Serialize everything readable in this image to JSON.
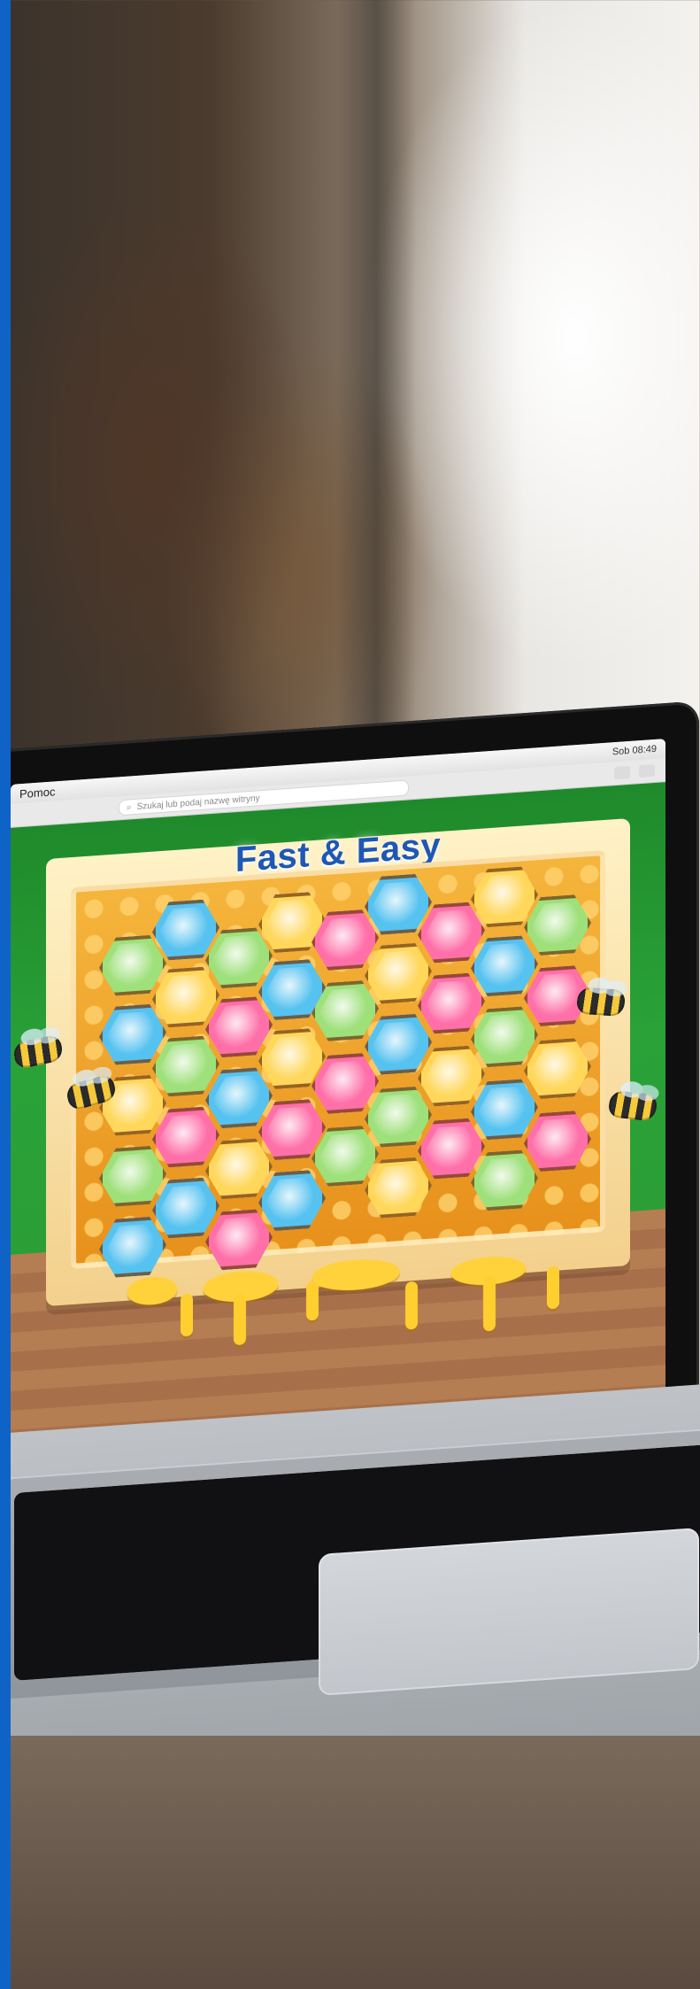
{
  "browser": {
    "menu_item": "Pomoc",
    "search_placeholder": "Szukaj lub podaj nazwę witryny",
    "status_time": "Sob 08:49"
  },
  "game": {
    "title": "Fast & Easy"
  },
  "colors": {
    "accent_stripe": "#0f63c7",
    "title_blue": "#1e57b7"
  }
}
